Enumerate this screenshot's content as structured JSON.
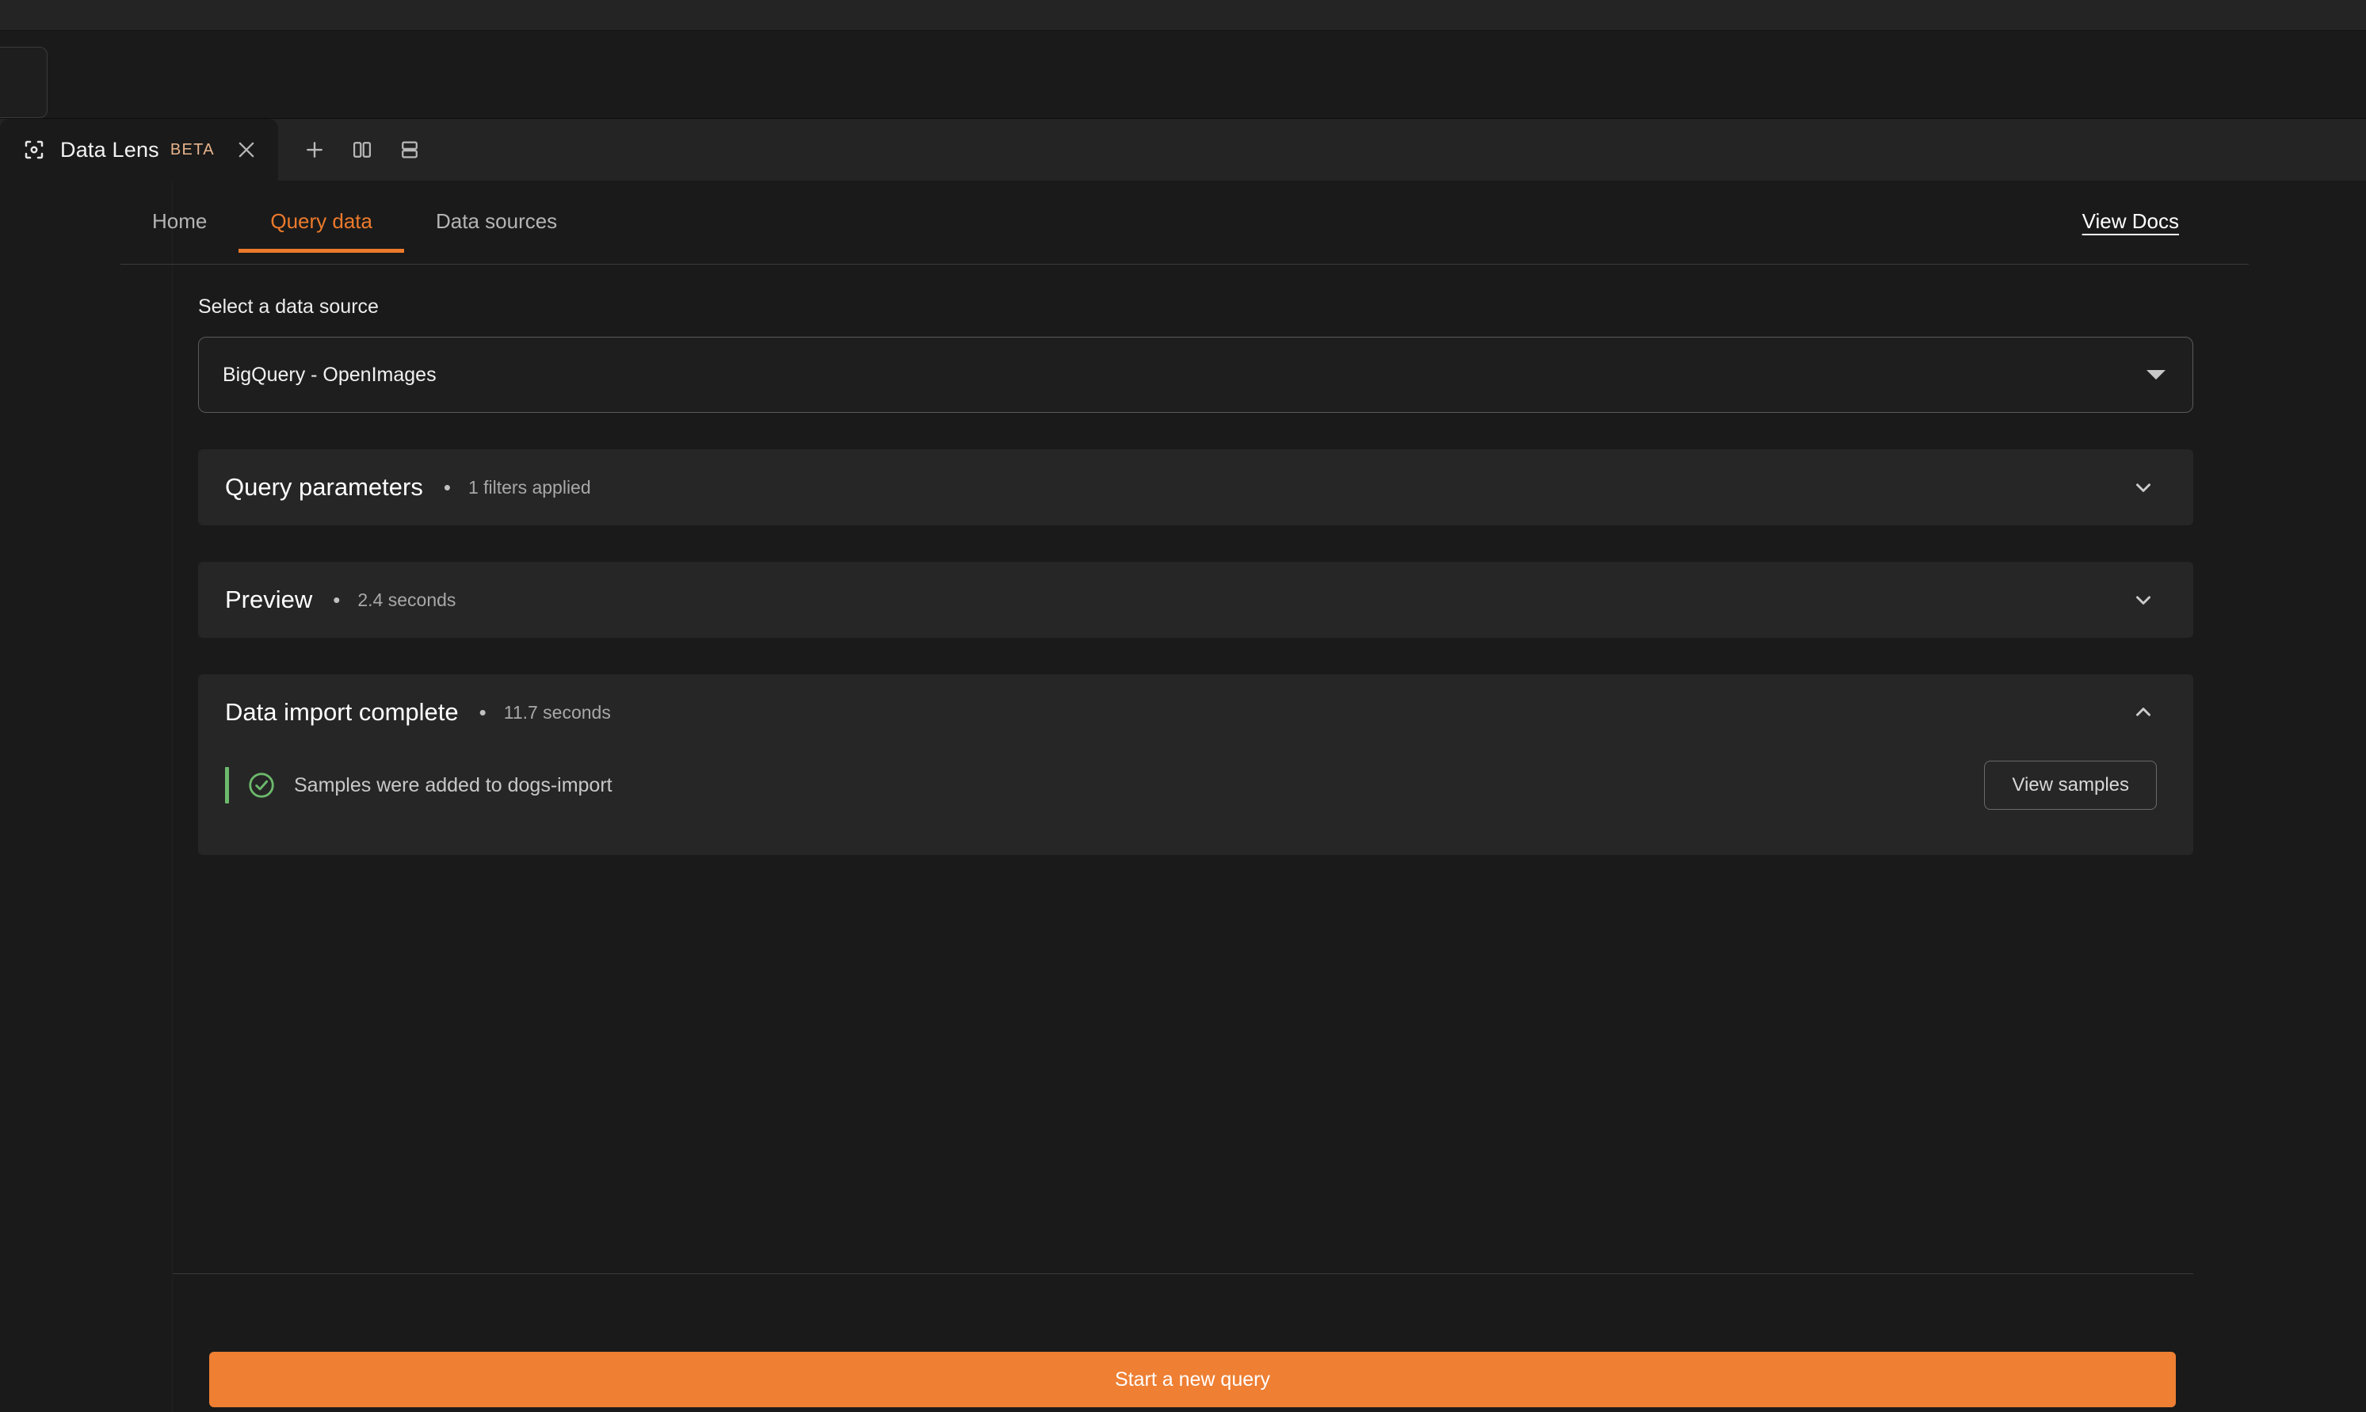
{
  "window": {
    "tab": {
      "icon": "scan-focus-icon",
      "title": "Data Lens",
      "badge": "BETA",
      "close_icon": "close-icon"
    },
    "actions": [
      {
        "name": "new-tab-button",
        "icon": "plus-icon"
      },
      {
        "name": "split-vertical-button",
        "icon": "split-vertical-icon"
      },
      {
        "name": "split-horizontal-button",
        "icon": "split-horizontal-icon"
      }
    ]
  },
  "nav": {
    "tabs": [
      {
        "label": "Home",
        "active": false
      },
      {
        "label": "Query data",
        "active": true
      },
      {
        "label": "Data sources",
        "active": false
      }
    ],
    "docs_link": "View Docs"
  },
  "main": {
    "datasource": {
      "label": "Select a data source",
      "value": "BigQuery - OpenImages",
      "caret_icon": "triangle-down-icon"
    },
    "sections": [
      {
        "title": "Query parameters",
        "separator": "•",
        "meta": "1 filters applied",
        "expanded": false,
        "chevron_icon": "chevron-down-icon"
      },
      {
        "title": "Preview",
        "separator": "•",
        "meta": "2.4 seconds",
        "expanded": false,
        "chevron_icon": "chevron-down-icon"
      },
      {
        "title": "Data import complete",
        "separator": "•",
        "meta": "11.7 seconds",
        "expanded": true,
        "chevron_icon": "chevron-up-icon"
      }
    ],
    "import_result": {
      "status_icon": "check-circle-icon",
      "message": "Samples were added to dogs-import",
      "action_label": "View samples"
    }
  },
  "footer": {
    "primary_label": "Start a new query"
  },
  "colors": {
    "accent": "#ec7a2c",
    "primary_button": "#ee7f33",
    "beta_badge": "#e8b48c",
    "success": "#6cb96c",
    "page_bg": "#1a1a1a",
    "card_bg": "#262626",
    "chrome_bg": "#242424"
  }
}
